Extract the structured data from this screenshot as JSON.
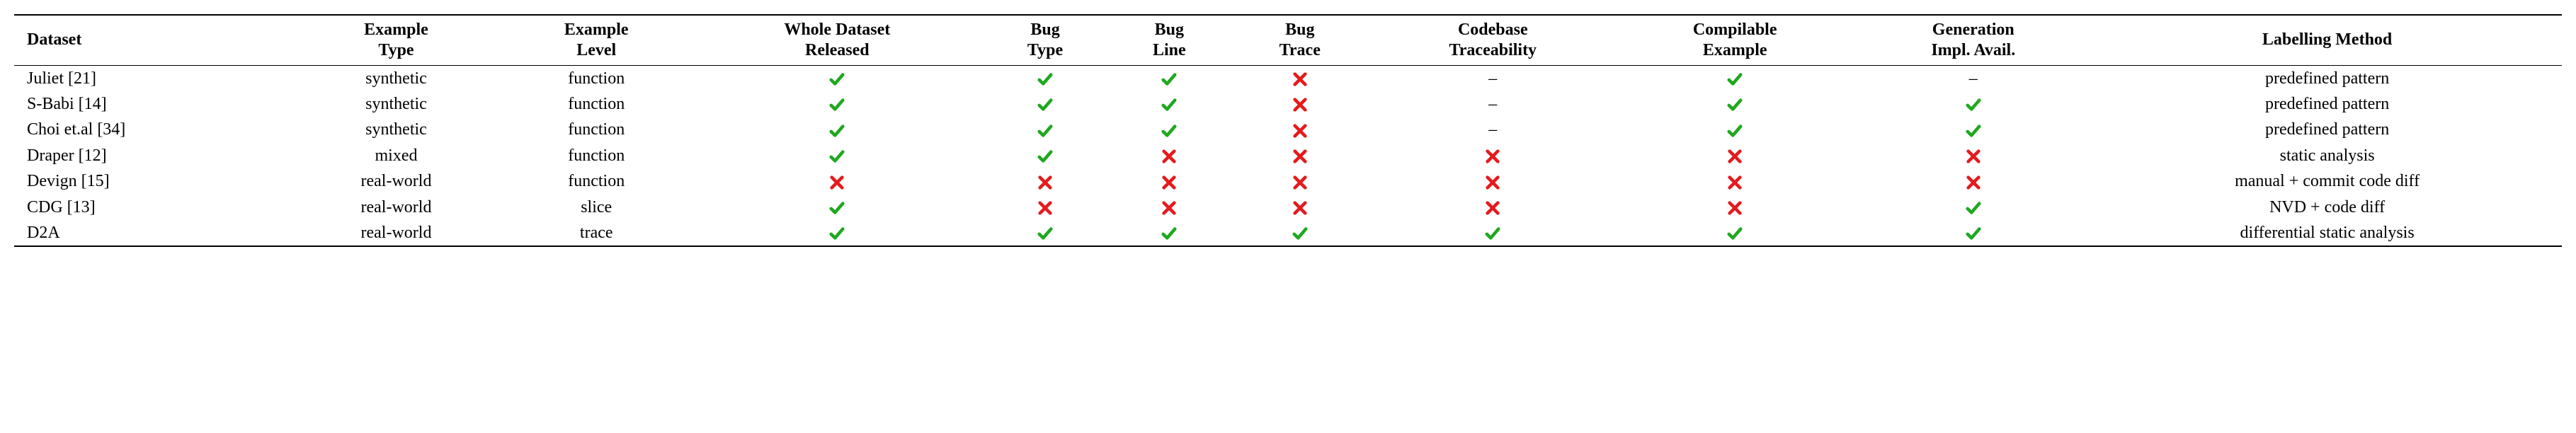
{
  "chart_data": {
    "type": "table",
    "columns": [
      {
        "key": "dataset",
        "label": "Dataset"
      },
      {
        "key": "example_type",
        "label": "Example\nType"
      },
      {
        "key": "example_level",
        "label": "Example\nLevel"
      },
      {
        "key": "whole_dataset_released",
        "label": "Whole Dataset\nReleased"
      },
      {
        "key": "bug_type",
        "label": "Bug\nType"
      },
      {
        "key": "bug_line",
        "label": "Bug\nLine"
      },
      {
        "key": "bug_trace",
        "label": "Bug\nTrace"
      },
      {
        "key": "codebase_traceability",
        "label": "Codebase\nTraceability"
      },
      {
        "key": "compilable_example",
        "label": "Compilable\nExample"
      },
      {
        "key": "generation_impl_avail",
        "label": "Generation\nImpl. Avail."
      },
      {
        "key": "labelling_method",
        "label": "Labelling Method"
      }
    ],
    "rows": [
      {
        "dataset": "Juliet [21]",
        "example_type": "synthetic",
        "example_level": "function",
        "whole_dataset_released": "check",
        "bug_type": "check",
        "bug_line": "check",
        "bug_trace": "cross",
        "codebase_traceability": "dash",
        "compilable_example": "check",
        "generation_impl_avail": "dash",
        "labelling_method": "predefined pattern"
      },
      {
        "dataset": "S-Babi [14]",
        "example_type": "synthetic",
        "example_level": "function",
        "whole_dataset_released": "check",
        "bug_type": "check",
        "bug_line": "check",
        "bug_trace": "cross",
        "codebase_traceability": "dash",
        "compilable_example": "check",
        "generation_impl_avail": "check",
        "labelling_method": "predefined pattern"
      },
      {
        "dataset": "Choi et.al [34]",
        "example_type": "synthetic",
        "example_level": "function",
        "whole_dataset_released": "check",
        "bug_type": "check",
        "bug_line": "check",
        "bug_trace": "cross",
        "codebase_traceability": "dash",
        "compilable_example": "check",
        "generation_impl_avail": "check",
        "labelling_method": "predefined pattern"
      },
      {
        "dataset": "Draper [12]",
        "example_type": "mixed",
        "example_level": "function",
        "whole_dataset_released": "check",
        "bug_type": "check",
        "bug_line": "cross",
        "bug_trace": "cross",
        "codebase_traceability": "cross",
        "compilable_example": "cross",
        "generation_impl_avail": "cross",
        "labelling_method": "static analysis"
      },
      {
        "dataset": "Devign [15]",
        "example_type": "real-world",
        "example_level": "function",
        "whole_dataset_released": "cross",
        "bug_type": "cross",
        "bug_line": "cross",
        "bug_trace": "cross",
        "codebase_traceability": "cross",
        "compilable_example": "cross",
        "generation_impl_avail": "cross",
        "labelling_method": "manual + commit code diff"
      },
      {
        "dataset": "CDG [13]",
        "example_type": "real-world",
        "example_level": "slice",
        "whole_dataset_released": "check",
        "bug_type": "cross",
        "bug_line": "cross",
        "bug_trace": "cross",
        "codebase_traceability": "cross",
        "compilable_example": "cross",
        "generation_impl_avail": "check",
        "labelling_method": "NVD + code diff"
      },
      {
        "dataset": "D2A",
        "example_type": "real-world",
        "example_level": "trace",
        "whole_dataset_released": "check",
        "bug_type": "check",
        "bug_line": "check",
        "bug_trace": "check",
        "codebase_traceability": "check",
        "compilable_example": "check",
        "generation_impl_avail": "check",
        "labelling_method": "differential static analysis"
      }
    ]
  }
}
